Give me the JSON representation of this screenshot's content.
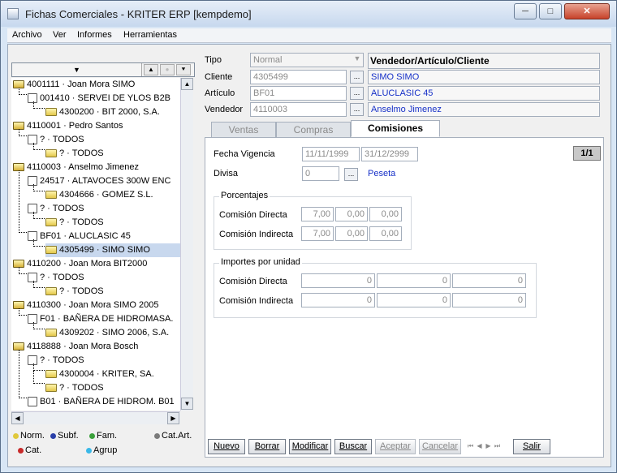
{
  "window": {
    "title": "Fichas Comerciales - KRITER ERP  [kempdemo]",
    "min": "─",
    "max": "□",
    "close": "✕"
  },
  "menu": [
    "Archivo",
    "Ver",
    "Informes",
    "Herramientas"
  ],
  "tree": {
    "header_dd": "▼",
    "header_up": "▲",
    "header_mid": "●",
    "header_down": "⯆",
    "rows": [
      {
        "text": "4001111 · Joan Mora SIMO"
      },
      {
        "text": "001410 · SERVEI DE YLOS B2B"
      },
      {
        "text": "4300200 · BIT 2000, S.A."
      },
      {
        "text": "4110001 · Pedro Santos"
      },
      {
        "text": "? · TODOS"
      },
      {
        "text": "? · TODOS"
      },
      {
        "text": "4110003 · Anselmo Jimenez"
      },
      {
        "text": "24517 · ALTAVOCES 300W ENC"
      },
      {
        "text": "4304666 · GOMEZ S.L."
      },
      {
        "text": "? · TODOS"
      },
      {
        "text": "? · TODOS"
      },
      {
        "text": "BF01 · ALUCLASIC 45"
      },
      {
        "text": "4305499 · SIMO SIMO"
      },
      {
        "text": "4110200 · Joan Mora BIT2000"
      },
      {
        "text": "? · TODOS"
      },
      {
        "text": "? · TODOS"
      },
      {
        "text": "4110300 · Joan Mora SIMO 2005"
      },
      {
        "text": "F01 · BAÑERA DE HIDROMASA."
      },
      {
        "text": "4309202 · SIMO 2006, S.A."
      },
      {
        "text": "4118888 · Joan Mora Bosch"
      },
      {
        "text": "? · TODOS"
      },
      {
        "text": "4300004 · KRITER, SA."
      },
      {
        "text": "? · TODOS"
      },
      {
        "text": "B01 · BAÑERA DE HIDROM. B01"
      }
    ]
  },
  "legend": {
    "norm": "Norm.",
    "subf": "Subf.",
    "fam": "Fam.",
    "catart": "Cat.Art.",
    "cat": "Cat.",
    "agrup": "Agrup"
  },
  "form": {
    "tipo_label": "Tipo",
    "tipo_value": "Normal",
    "tipo_header": "Vendedor/Artículo/Cliente",
    "cliente_label": "Cliente",
    "cliente_value": "4305499",
    "cliente_desc": "SIMO SIMO",
    "articulo_label": "Artículo",
    "articulo_value": "BF01",
    "articulo_desc": "ALUCLASIC 45",
    "vendedor_label": "Vendedor",
    "vendedor_value": "4110003",
    "vendedor_desc": "Anselmo Jimenez",
    "ellipsis": "..."
  },
  "tabs": [
    "Ventas",
    "Compras",
    "Comisiones"
  ],
  "comisiones": {
    "fecha_label": "Fecha Vigencia",
    "fecha_desde": "11/11/1999",
    "fecha_hasta": "31/12/2999",
    "pager": "1/1",
    "divisa_label": "Divisa",
    "divisa_value": "0",
    "divisa_desc": "Peseta",
    "porcentajes_title": "Porcentajes",
    "directa_label": "Comisión Directa",
    "indirecta_label": "Comisión Indirecta",
    "pct_directa": [
      "7,00",
      "0,00",
      "0,00"
    ],
    "pct_indirecta": [
      "7,00",
      "0,00",
      "0,00"
    ],
    "importes_title": "Importes por unidad",
    "imp_directa": [
      "0",
      "0",
      "0"
    ],
    "imp_indirecta": [
      "0",
      "0",
      "0"
    ]
  },
  "buttons": {
    "nuevo": "Nuevo",
    "borrar": "Borrar",
    "modificar": "Modificar",
    "buscar": "Buscar",
    "aceptar": "Aceptar",
    "cancelar": "Cancelar",
    "salir": "Salir"
  },
  "nav": [
    "⏮",
    "◀",
    "▶",
    "⏭"
  ]
}
